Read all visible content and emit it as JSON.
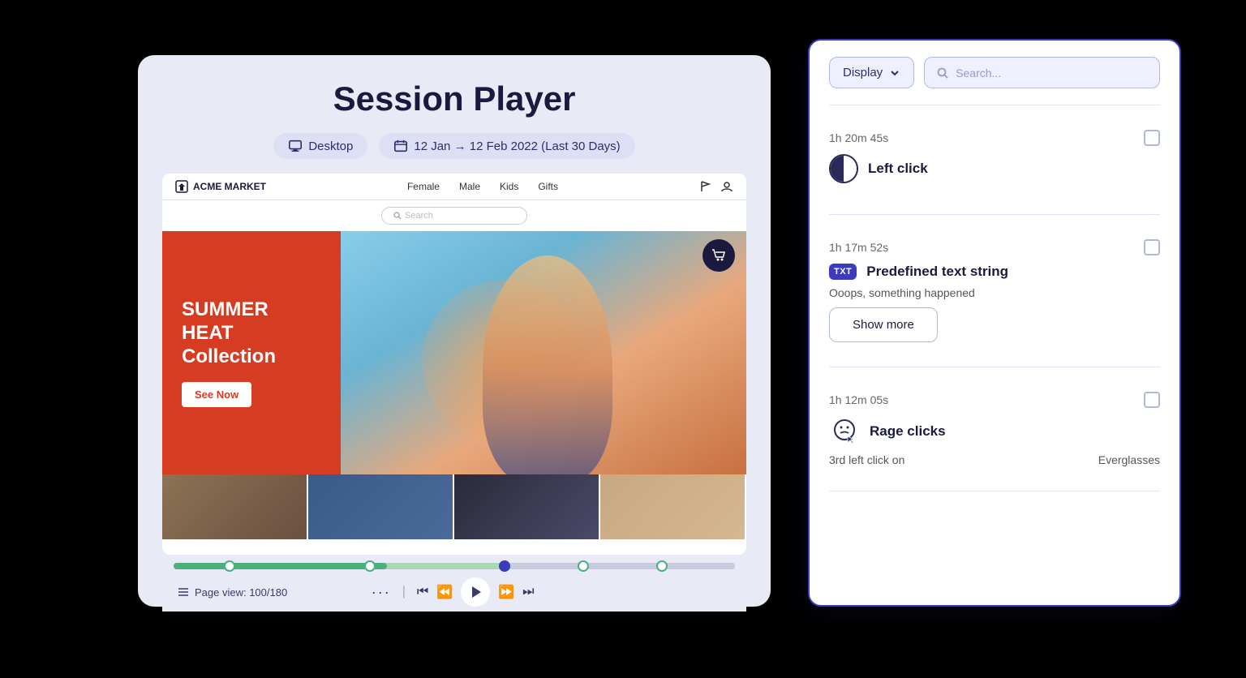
{
  "session_player": {
    "title": "Session Player",
    "device_label": "Desktop",
    "date_range": "12 Jan → 12 Feb 2022 (Last 30 Days)",
    "page_view": "Page view: 100/180"
  },
  "browser": {
    "brand": "ACME MARKET",
    "nav_links": [
      "Female",
      "Male",
      "Kids",
      "Gifts"
    ],
    "search_placeholder": "Search",
    "hero": {
      "title_line1": "SUMMER",
      "title_line2": "HEAT",
      "title_line3": "Collection",
      "cta": "See Now"
    }
  },
  "panel": {
    "display_label": "Display",
    "search_placeholder": "Search...",
    "events": [
      {
        "time": "1h 20m 45s",
        "icon_type": "half-circle",
        "name": "Left click",
        "sub": null,
        "has_show_more": false
      },
      {
        "time": "1h 17m 52s",
        "icon_type": "txt",
        "name": "Predefined text string",
        "sub": "Ooops, something happened",
        "has_show_more": true,
        "show_more_label": "Show more"
      },
      {
        "time": "1h 12m 05s",
        "icon_type": "rage",
        "name": "Rage clicks",
        "sub": "3rd left click on",
        "product": "Everglasses"
      }
    ]
  }
}
